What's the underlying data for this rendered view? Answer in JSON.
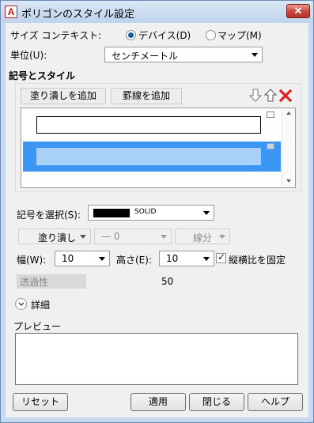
{
  "window": {
    "title": "ポリゴンのスタイル設定",
    "close_label": "✕"
  },
  "context": {
    "label": "サイズ コンテキスト:",
    "option_device": "デバイス(D)",
    "option_map": "マップ(M)",
    "selected": "device"
  },
  "unit": {
    "label": "単位(U):",
    "value": "センチメートル"
  },
  "symbols": {
    "section_title": "記号とスタイル",
    "add_fill_label": "塗り潰しを追加",
    "add_border_label": "罫線を追加"
  },
  "select_symbol": {
    "label": "記号を選択(S):",
    "value": "SOLID",
    "swatch_color": "#000000"
  },
  "fill_type": {
    "value": "塗り潰し"
  },
  "line_type": {
    "value": "— 0"
  },
  "line_part": {
    "value": "線分"
  },
  "width": {
    "label": "幅(W):",
    "value": "10"
  },
  "height": {
    "label": "高さ(E):",
    "value": "10"
  },
  "aspect": {
    "label": "縦横比を固定",
    "checked": true
  },
  "transparency": {
    "label": "透過性",
    "value": "50"
  },
  "details": {
    "label": "詳細"
  },
  "preview": {
    "label": "プレビュー"
  },
  "footer": {
    "reset_label": "リセット",
    "apply_label": "適用",
    "close_label": "閉じる",
    "help_label": "ヘルプ"
  },
  "colors": {
    "selection": "#3a96f2",
    "selection_inner": "#a9d1f7"
  }
}
